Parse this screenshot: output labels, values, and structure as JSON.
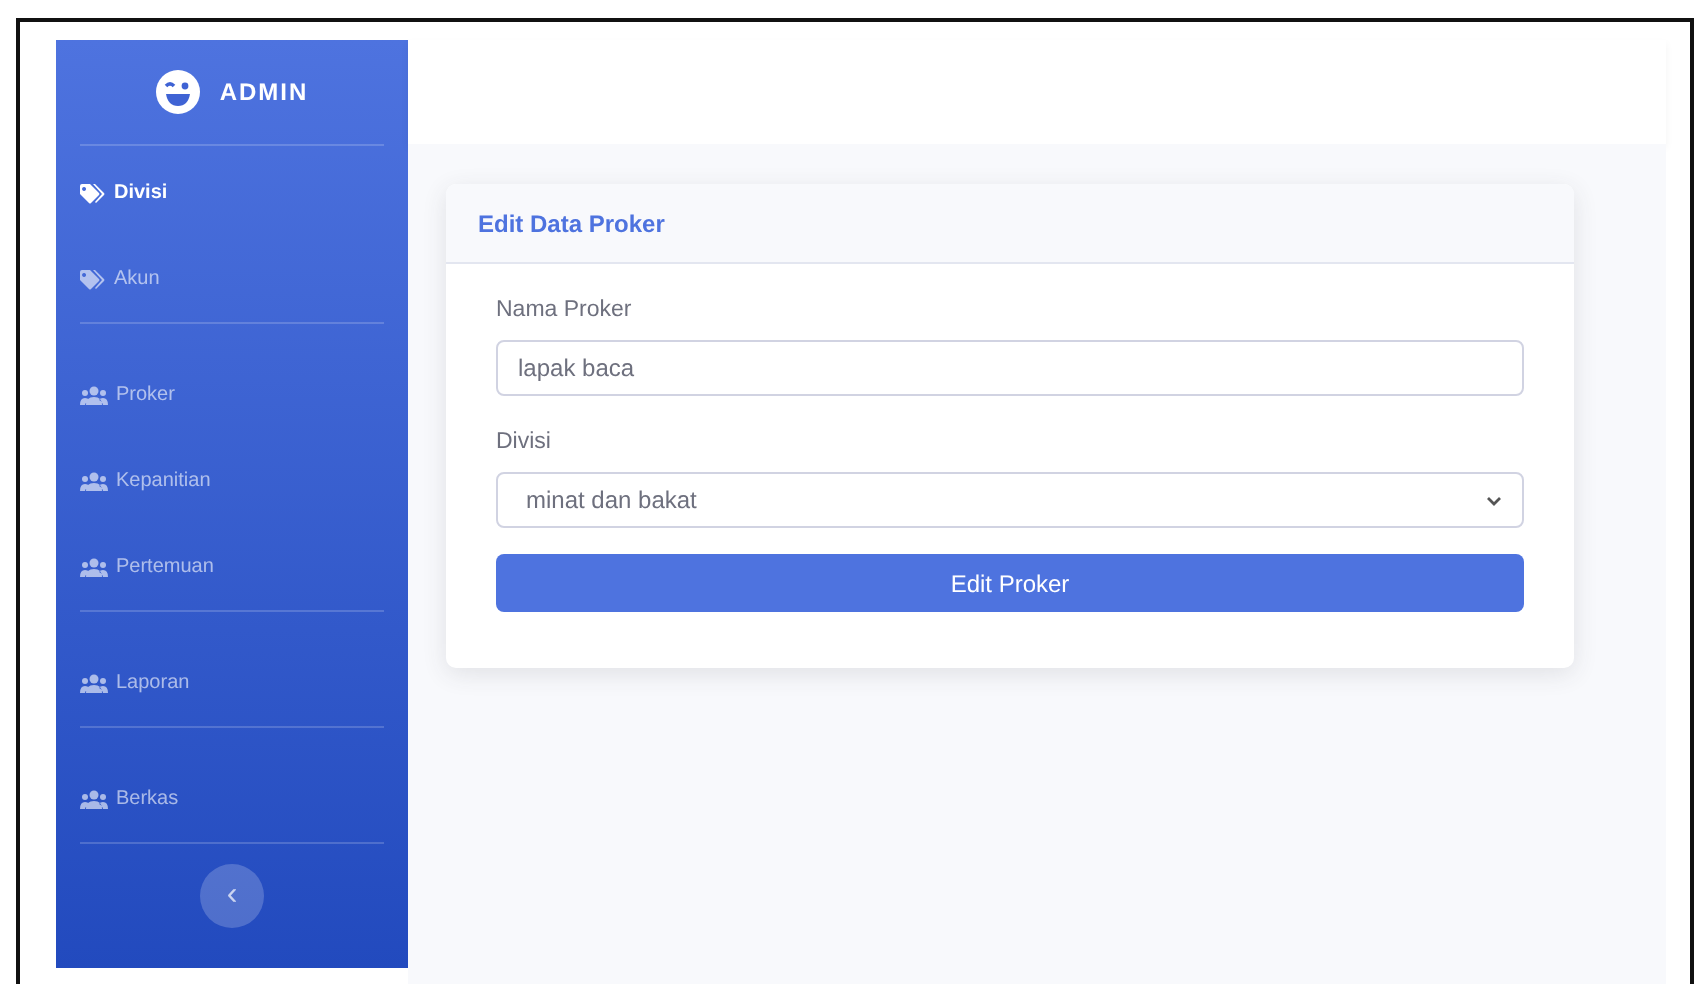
{
  "sidebar": {
    "brand": "ADMIN",
    "groups": [
      {
        "items": [
          {
            "label": "Divisi",
            "kind": "tag",
            "selected": true
          },
          {
            "label": "Akun",
            "kind": "tag",
            "selected": false
          }
        ]
      },
      {
        "items": [
          {
            "label": "Proker",
            "kind": "users",
            "selected": false
          },
          {
            "label": "Kepanitian",
            "kind": "users",
            "selected": false
          },
          {
            "label": "Pertemuan",
            "kind": "users",
            "selected": false
          }
        ]
      },
      {
        "items": [
          {
            "label": "Laporan",
            "kind": "users",
            "selected": false
          }
        ]
      },
      {
        "items": [
          {
            "label": "Berkas",
            "kind": "users",
            "selected": false
          }
        ]
      }
    ],
    "toggle": "‹"
  },
  "card": {
    "title": "Edit Data Proker",
    "fields": [
      {
        "kind": "text",
        "label": "Nama Proker",
        "value": "lapak baca"
      },
      {
        "kind": "select",
        "label": "Divisi",
        "value": "minat dan bakat"
      }
    ],
    "button": "Edit Proker"
  }
}
